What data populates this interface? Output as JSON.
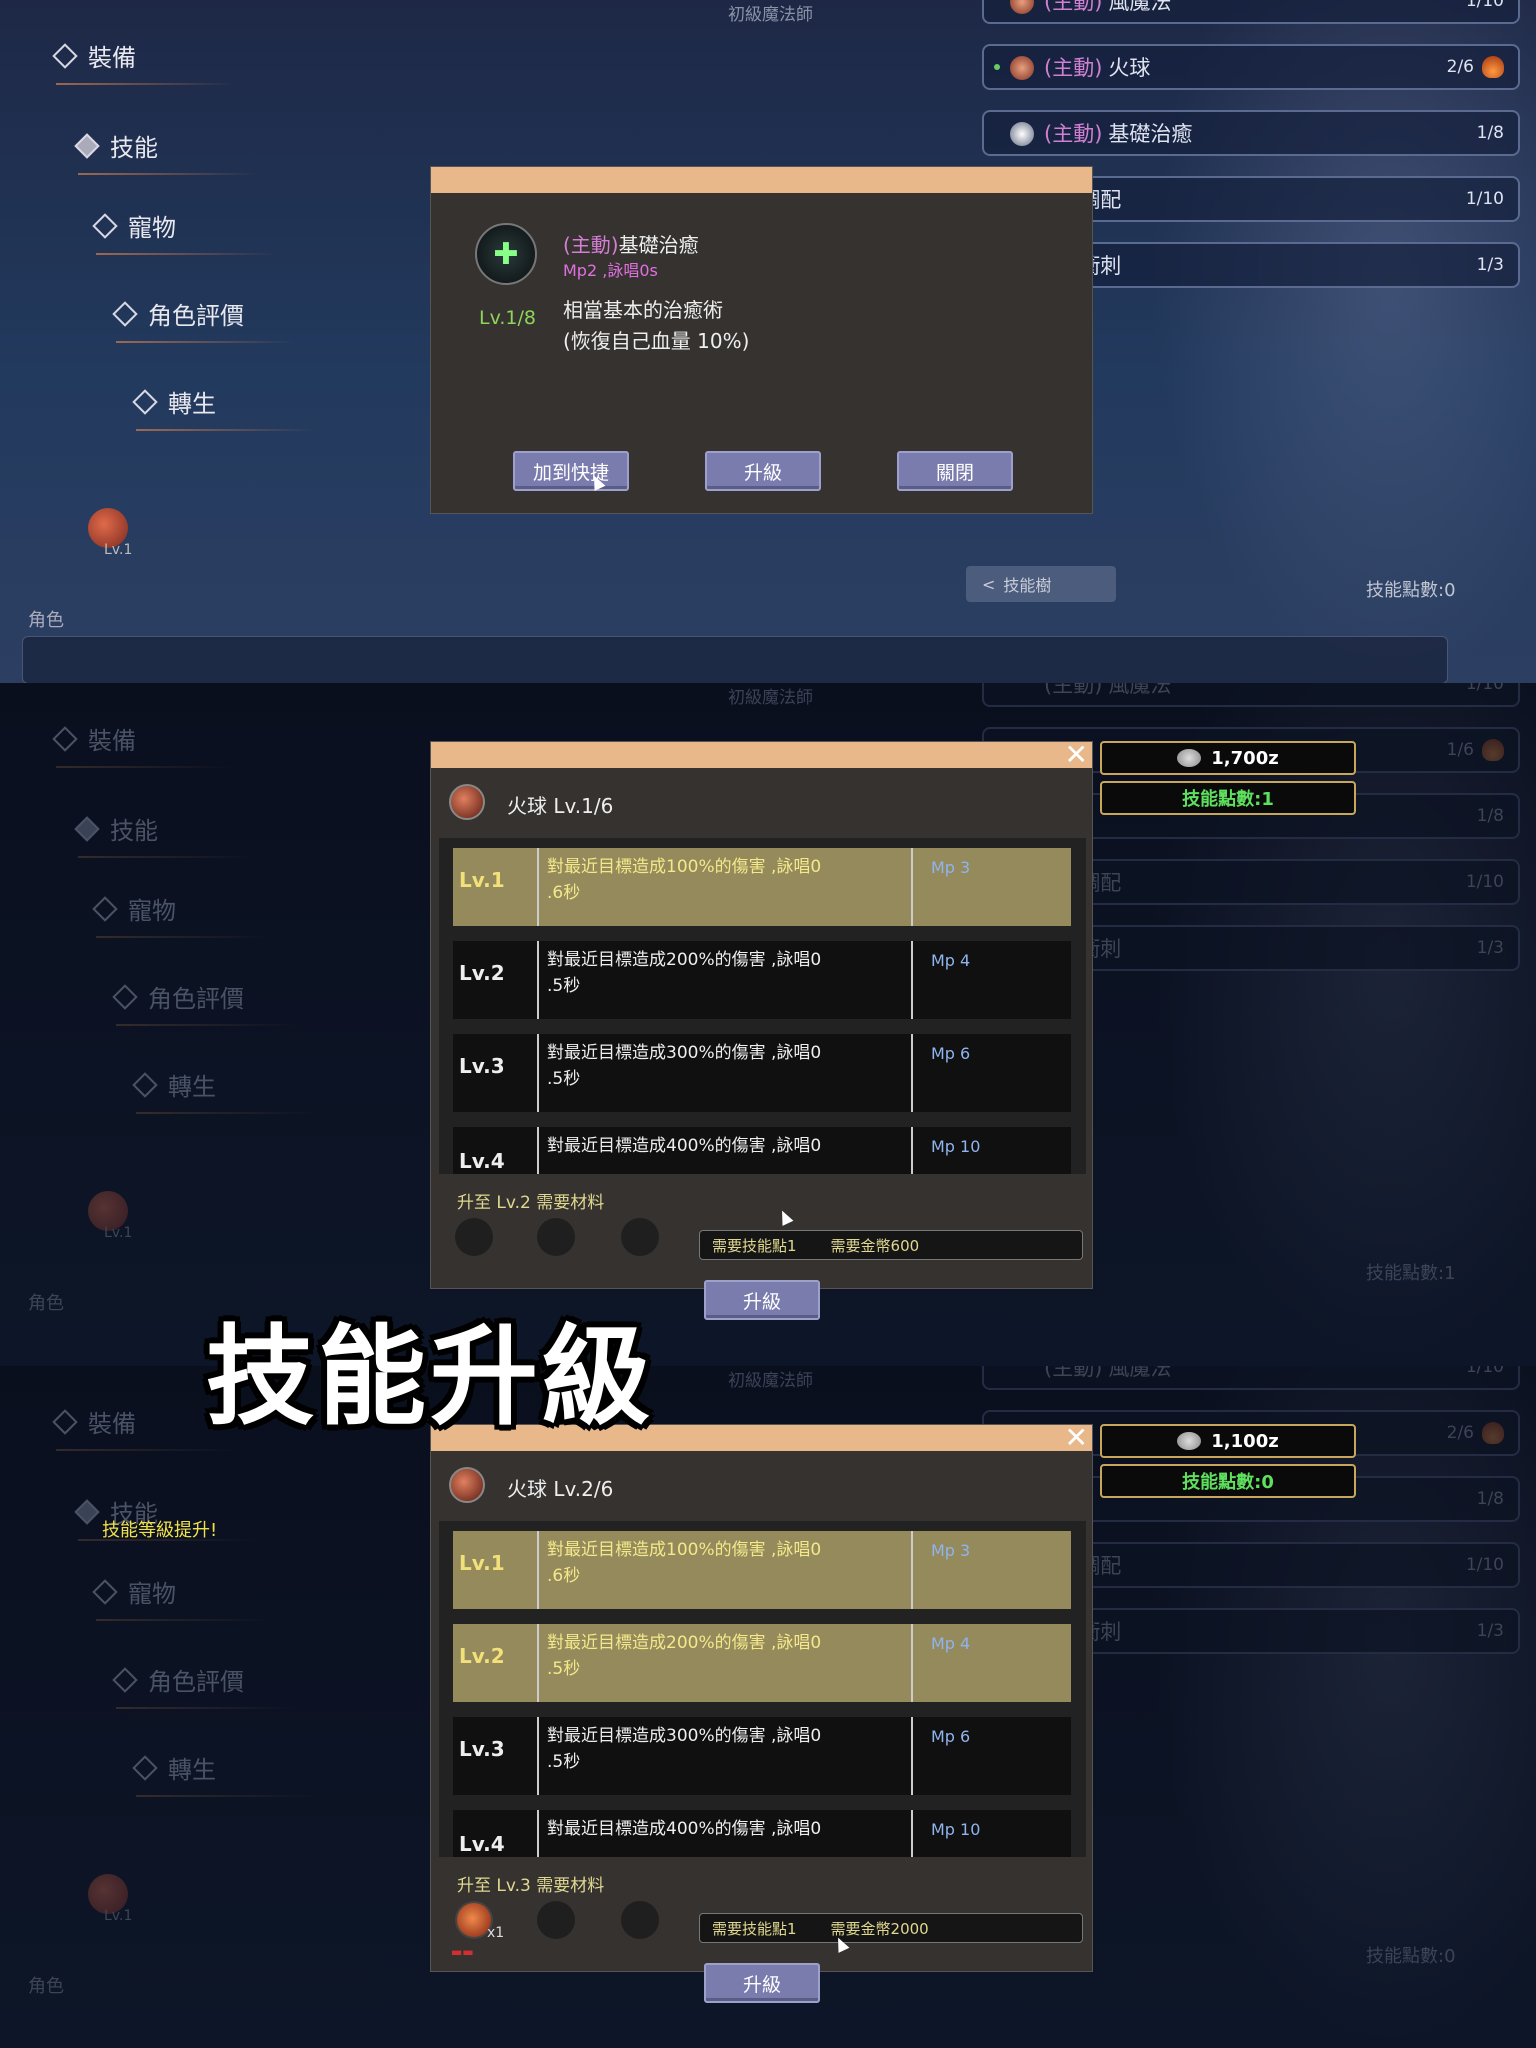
{
  "menu": {
    "items": [
      {
        "label": "裝備"
      },
      {
        "label": "技能"
      },
      {
        "label": "寵物"
      },
      {
        "label": "角色評價"
      },
      {
        "label": "轉生"
      }
    ],
    "char_level": "Lv.1",
    "role_label": "角色",
    "job_caption": "初級魔法師"
  },
  "skill_list": {
    "row0": {
      "tag": "(主動)",
      "name": "風魔法",
      "level": "1/10"
    },
    "row1": {
      "tag": "(主動)",
      "name": "火球",
      "level_p1": "2/6",
      "level_p2": "1/6",
      "level_p3": "2/6"
    },
    "row2": {
      "tag": "(主動)",
      "name": "基礎治癒",
      "level": "1/8"
    },
    "row3": {
      "tag": "動)",
      "name": "調配",
      "level": "1/10"
    },
    "row4": {
      "tag": "動)",
      "name": "衝刺",
      "level": "1/3"
    },
    "tree_button": "技能樹",
    "skill_points_p1": "技能點數:0",
    "skill_points_p2": "技能點數:1",
    "skill_points_p3": "技能點數:0"
  },
  "heal_dialog": {
    "tag": "(主動)",
    "name": "基礎治癒",
    "cost": "Mp2 ,詠唱0s",
    "level": "Lv.1/8",
    "desc_line1": "相當基本的治癒術",
    "desc_line2": "(恢復自己血量 10%)",
    "buttons": {
      "add_shortcut": "加到快捷",
      "upgrade": "升級",
      "close": "關閉"
    }
  },
  "upgrade_dialog_1": {
    "title": "火球 Lv.1/6",
    "gold": "1,700z",
    "skill_points": "技能點數:1",
    "req_title": "升至 Lv.2 需要材料",
    "req_sp": "需要技能點1",
    "req_gold": "需要金幣600",
    "upgrade_label": "升級"
  },
  "upgrade_dialog_2": {
    "title": "火球 Lv.2/6",
    "gold": "1,100z",
    "skill_points": "技能點數:0",
    "req_title": "升至 Lv.3 需要材料",
    "req_sp": "需要技能點1",
    "req_gold": "需要金幣2000",
    "item_count": "x1",
    "upgrade_label": "升級",
    "toast": "技能等級提升!"
  },
  "levels": [
    {
      "lv": "Lv.1",
      "desc1": "對最近目標造成100%的傷害 ,詠唱0",
      "desc2": ".6秒",
      "mp": "Mp 3"
    },
    {
      "lv": "Lv.2",
      "desc1": "對最近目標造成200%的傷害 ,詠唱0",
      "desc2": ".5秒",
      "mp": "Mp 4"
    },
    {
      "lv": "Lv.3",
      "desc1": "對最近目標造成300%的傷害 ,詠唱0",
      "desc2": ".5秒",
      "mp": "Mp 6"
    },
    {
      "lv": "Lv.4",
      "desc1": "對最近目標造成400%的傷害 ,詠唱0",
      "desc2": "",
      "mp": "Mp 10"
    }
  ],
  "caption": "技能升級",
  "colors": {
    "dialog_bg": "#353230",
    "topbar": "#e8b88a",
    "button": "#7a7cae",
    "done_row": "#948a5c",
    "gold_border": "#c9a75a"
  }
}
